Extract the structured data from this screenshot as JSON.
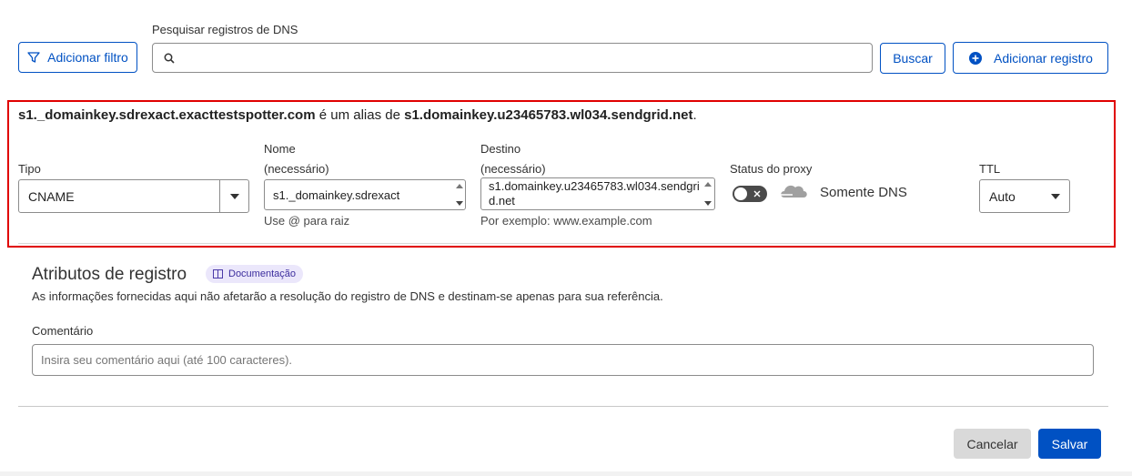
{
  "toolbar": {
    "add_filter_label": "Adicionar filtro",
    "search_label": "Pesquisar registros de DNS",
    "search_value": "",
    "search_button_label": "Buscar",
    "add_record_label": "Adicionar registro"
  },
  "record": {
    "alias_name": "s1._domainkey.sdrexact.exacttestspotter.com",
    "alias_mid": " é um alias de ",
    "alias_target": "s1.domainkey.u23465783.wl034.sendgrid.net",
    "alias_end": ".",
    "type_label": "Tipo",
    "type_value": "CNAME",
    "name_label": "Nome",
    "name_required": "(necessário)",
    "name_value": "s1._domainkey.sdrexact",
    "name_hint": "Use @ para raiz",
    "target_label": "Destino",
    "target_required": "(necessário)",
    "target_value": "s1.domainkey.u23465783.wl034.sendgrid.net",
    "target_hint": "Por exemplo: www.example.com",
    "proxy_label": "Status do proxy",
    "proxy_status": "Somente DNS",
    "proxy_on": false,
    "ttl_label": "TTL",
    "ttl_value": "Auto"
  },
  "attributes": {
    "title": "Atributos de registro",
    "doc_label": "Documentação",
    "description": "As informações fornecidas aqui não afetarão a resolução do registro de DNS e destinam-se apenas para sua referência.",
    "comment_label": "Comentário",
    "comment_placeholder": "Insira seu comentário aqui (até 100 caracteres)."
  },
  "footer": {
    "cancel_label": "Cancelar",
    "save_label": "Salvar"
  },
  "colors": {
    "accent": "#0051c3",
    "highlight_border": "#e00000",
    "doc_badge_bg": "#ebe7fb"
  },
  "icons": [
    "filter-icon",
    "search-icon",
    "plus-circle-icon",
    "chevron-down-icon",
    "cloud-icon",
    "doc-icon"
  ]
}
